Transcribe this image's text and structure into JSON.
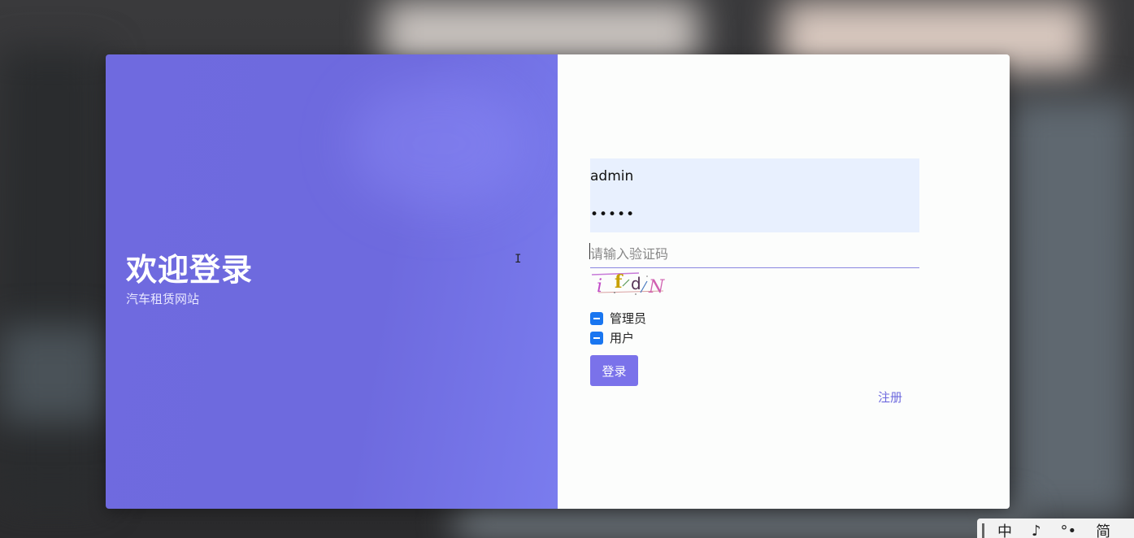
{
  "welcome": {
    "title": "欢迎登录",
    "subtitle": "汽车租赁网站"
  },
  "form": {
    "username_value": "admin",
    "password_value": "•••••",
    "captcha_placeholder": "请输入验证码",
    "captcha_text": "ifdN",
    "roles": [
      {
        "label": "管理员"
      },
      {
        "label": "用户"
      }
    ],
    "login_label": "登录",
    "register_label": "注册"
  },
  "ime": {
    "lang": "中",
    "moon": "♪",
    "punct": "°•",
    "mode": "简"
  },
  "colors": {
    "accent": "#7a72ea",
    "panel": "#6f6adf",
    "checkbox": "#1976f0",
    "autofill": "#e8f0fe"
  }
}
